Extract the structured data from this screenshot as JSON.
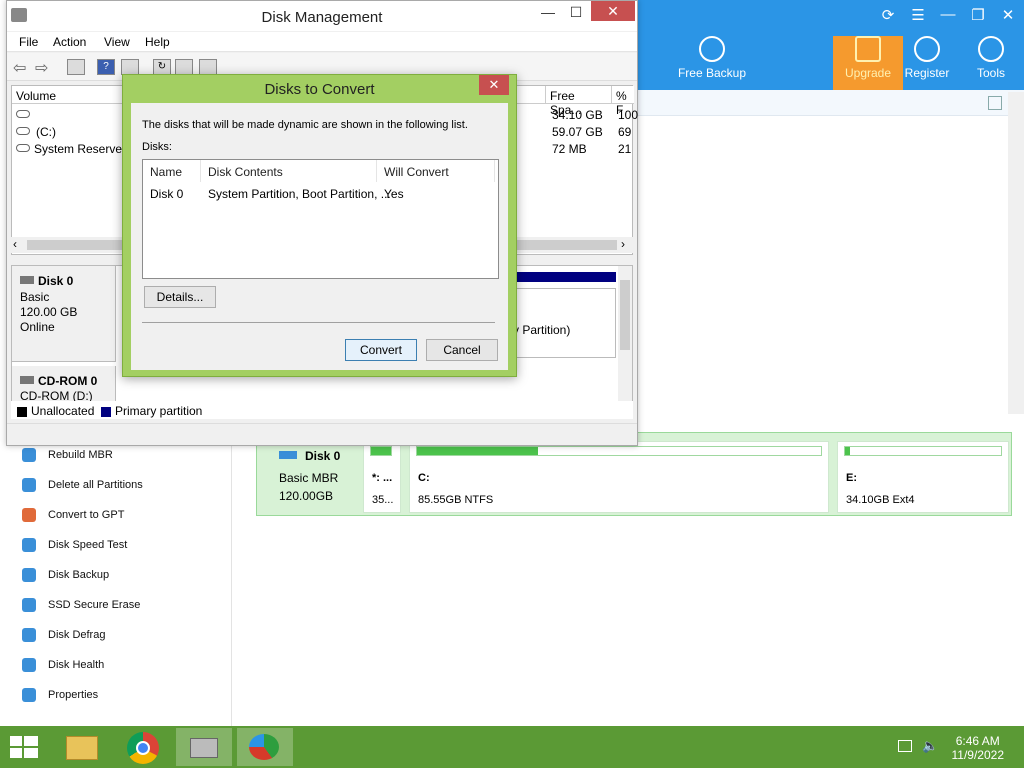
{
  "background_app": {
    "toolbar": [
      {
        "label": "Free Backup",
        "icon": "database-icon"
      },
      {
        "label": "Upgrade",
        "icon": "upgrade-arrow-icon"
      },
      {
        "label": "Register",
        "icon": "search-key-icon"
      },
      {
        "label": "Tools",
        "icon": "wrench-icon"
      }
    ],
    "left_menu": [
      {
        "label": "Rebuild MBR",
        "icon": "rebuild-icon"
      },
      {
        "label": "Delete all Partitions",
        "icon": "trash-icon"
      },
      {
        "label": "Convert to GPT",
        "icon": "convert-icon"
      },
      {
        "label": "Disk Speed Test",
        "icon": "speed-icon"
      },
      {
        "label": "Disk Backup",
        "icon": "backup-icon"
      },
      {
        "label": "SSD Secure Erase",
        "icon": "erase-icon"
      },
      {
        "label": "Disk Defrag",
        "icon": "defrag-icon"
      },
      {
        "label": "Disk Health",
        "icon": "health-icon"
      },
      {
        "label": "Properties",
        "icon": "properties-icon"
      }
    ],
    "disk_map": {
      "disk_name": "Disk 0",
      "disk_type": "Basic MBR",
      "disk_size": "120.00GB",
      "partitions": [
        {
          "label": "*: ...",
          "size": "35...",
          "fill": 1.0
        },
        {
          "label": "C:",
          "size": "85.55GB NTFS",
          "fill": 0.3
        },
        {
          "label": "E:",
          "size": "34.10GB Ext4",
          "fill": 0.03
        }
      ]
    }
  },
  "disk_management": {
    "title": "Disk Management",
    "menu": [
      "File",
      "Action",
      "View",
      "Help"
    ],
    "columns": {
      "volume": "Volume",
      "free_space": "Free Spa...",
      "percent": "% F"
    },
    "volumes": [
      {
        "name": "",
        "free": "34.10 GB",
        "pct": "100"
      },
      {
        "name": "(C:)",
        "free": "59.07 GB",
        "pct": "69"
      },
      {
        "name": "System Reserved",
        "free": "72 MB",
        "pct": "21"
      }
    ],
    "disk0": {
      "name": "Disk 0",
      "type": "Basic",
      "size": "120.00 GB",
      "status": "Online"
    },
    "cdrom": {
      "name": "CD-ROM 0",
      "drive": "CD-ROM (D:)"
    },
    "partition_text": "y Partition)",
    "legend": [
      {
        "label": "Unallocated",
        "color": "#000000"
      },
      {
        "label": "Primary partition",
        "color": "#000080"
      }
    ]
  },
  "dialog": {
    "title": "Disks to Convert",
    "message": "The disks that will be made dynamic are shown in the following list.",
    "disks_label": "Disks:",
    "columns": [
      "Name",
      "Disk Contents",
      "Will Convert"
    ],
    "rows": [
      {
        "name": "Disk 0",
        "contents": "System Partition, Boot Partition, ...",
        "convert": "Yes"
      }
    ],
    "details_button": "Details...",
    "convert_button": "Convert",
    "cancel_button": "Cancel"
  },
  "taskbar": {
    "apps": [
      "file-explorer-icon",
      "chrome-icon",
      "disk-management-icon",
      "partition-tool-icon"
    ],
    "time": "6:46 AM",
    "date": "11/9/2022"
  },
  "colors": {
    "taskbar": "#5b9a35",
    "dialog_frame": "#a3cf62",
    "app_header": "#2b95e6",
    "upgrade": "#f59a2e"
  }
}
